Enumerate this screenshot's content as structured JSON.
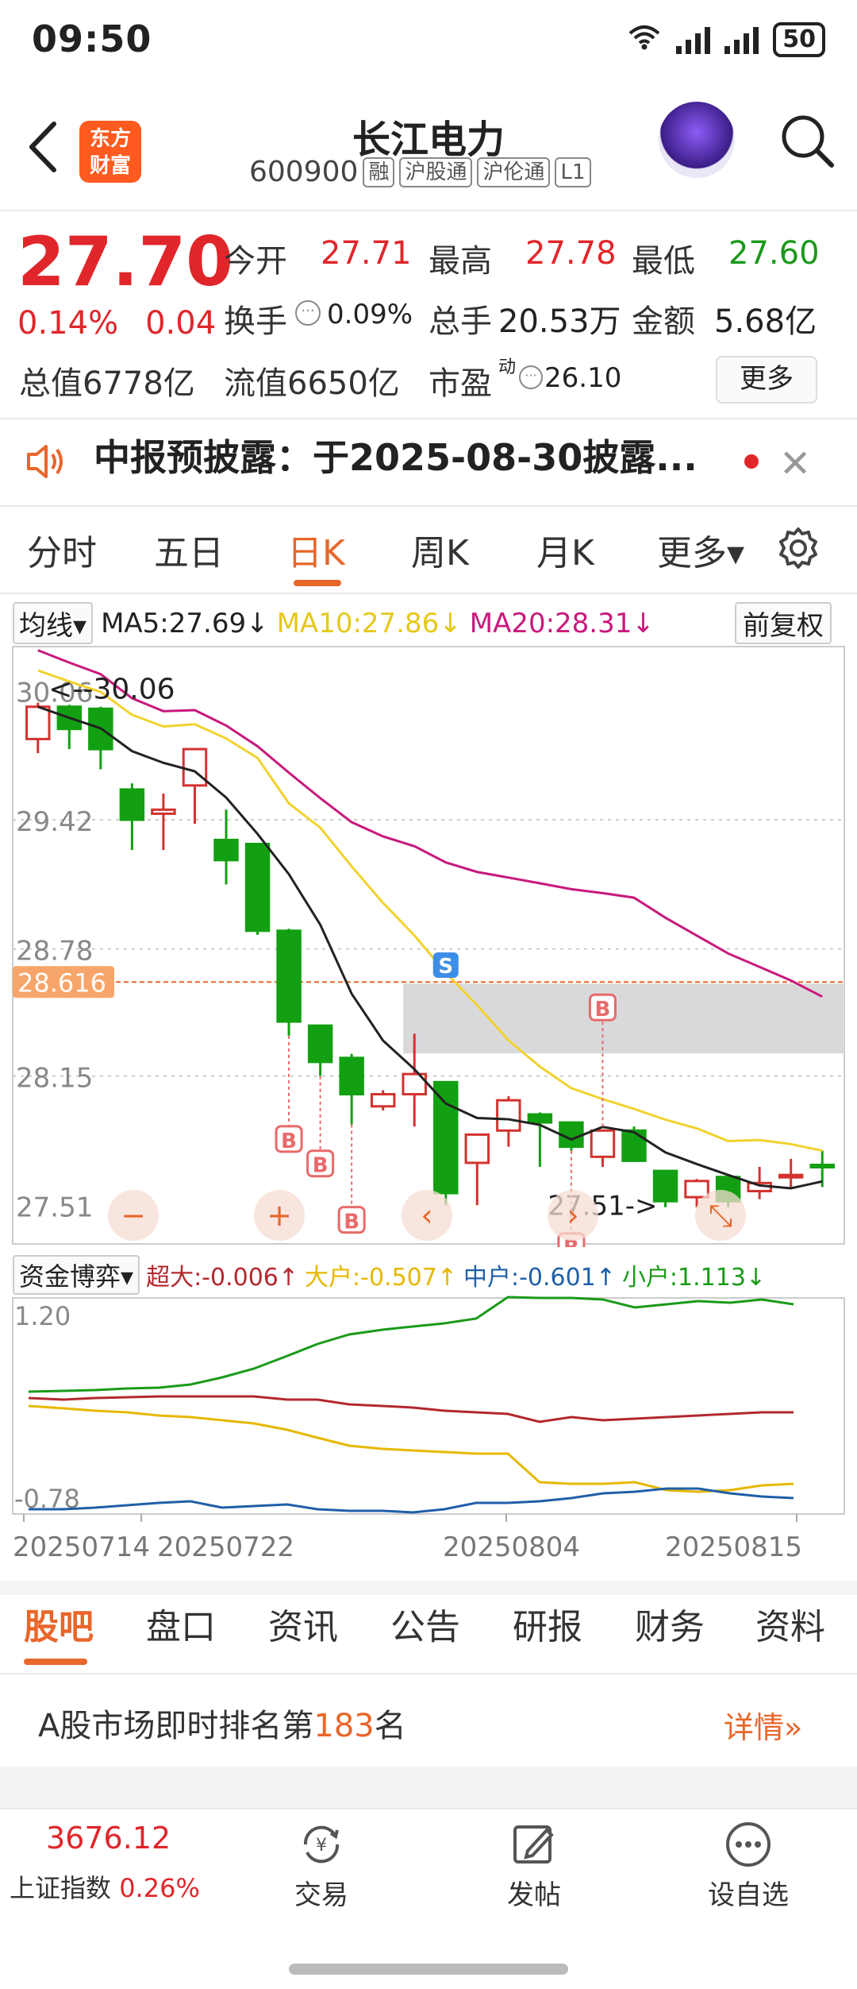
{
  "status": {
    "time": "09:50",
    "signal": "6G",
    "battery": "50"
  },
  "header": {
    "logo_line1": "东方",
    "logo_line2": "财富",
    "title": "长江电力",
    "code": "600900",
    "tags": [
      "融",
      "沪股通",
      "沪伦通",
      "L1"
    ]
  },
  "quote": {
    "price": "27.70",
    "pct": "0.14%",
    "chg": "0.04",
    "open_label": "今开",
    "open": "27.71",
    "high_label": "最高",
    "high": "27.78",
    "low_label": "最低",
    "low": "27.60",
    "turnover_label": "换手",
    "turnover": "0.09%",
    "volume_label": "总手",
    "volume": "20.53万",
    "amount_label": "金额",
    "amount": "5.68亿",
    "mktcap": "总值6778亿",
    "float": "流值6650亿",
    "pe_label": "市盈",
    "pe_sup": "动",
    "pe": "26.10",
    "more": "更多"
  },
  "notice": {
    "text": "中报预披露：于2025-08-30披露..."
  },
  "tabs": [
    "分时",
    "五日",
    "日K",
    "周K",
    "月K",
    "更多▾"
  ],
  "ma": {
    "selector": "均线▾",
    "ma5": "MA5:27.69↓",
    "ma10": "MA10:27.86↓",
    "ma20": "MA20:28.31↓",
    "adjust": "前复权",
    "colors": {
      "ma5": "#222222",
      "ma10": "#f2d22e",
      "ma20": "#c8197d"
    }
  },
  "kline": {
    "y_labels": [
      "30.06",
      "29.42",
      "28.78",
      "28.15",
      "27.51"
    ],
    "max_note": "<--30.06",
    "min_note": "27.51->",
    "price_line": "28.616",
    "buy_marker": "B",
    "sell_marker": "S"
  },
  "flow": {
    "selector": "资金博弈▾",
    "super": "超大:-0.006↑",
    "large": "大户:-0.507↑",
    "medium": "中户:-0.601↑",
    "small": "小户:1.113↓",
    "y_top": "1.20",
    "y_bottom": "-0.78",
    "colors": {
      "super": "#b3282e",
      "large": "#e6b800",
      "medium": "#1f5fa8",
      "small": "#1a9a1a"
    }
  },
  "dates": [
    "20250714",
    "20250722",
    "20250804",
    "20250815"
  ],
  "subtabs": [
    "股吧",
    "盘口",
    "资讯",
    "公告",
    "研报",
    "财务",
    "资料"
  ],
  "rank": {
    "prefix": "A股市场即时排名第",
    "num": "183",
    "suffix": "名",
    "detail": "详情»"
  },
  "bottom": {
    "index_value": "3676.12",
    "index_name": "上证指数",
    "index_pct": "0.26%",
    "items": [
      "交易",
      "发帖",
      "设自选"
    ]
  },
  "chart_data": {
    "type": "candlestick",
    "x": [
      "2025-07-14",
      "2025-07-15",
      "2025-07-16",
      "2025-07-17",
      "2025-07-18",
      "2025-07-21",
      "2025-07-22",
      "2025-07-23",
      "2025-07-24",
      "2025-07-25",
      "2025-07-28",
      "2025-07-29",
      "2025-07-30",
      "2025-07-31",
      "2025-08-01",
      "2025-08-04",
      "2025-08-05",
      "2025-08-06",
      "2025-08-07",
      "2025-08-08",
      "2025-08-11",
      "2025-08-12",
      "2025-08-13",
      "2025-08-14",
      "2025-08-15",
      "2025-08-18"
    ],
    "series": [
      {
        "name": "K",
        "ohlc": [
          [
            29.82,
            30.0,
            29.75,
            29.98
          ],
          [
            29.98,
            29.99,
            29.77,
            29.87
          ],
          [
            29.97,
            29.98,
            29.67,
            29.77
          ],
          [
            29.57,
            29.6,
            29.27,
            29.42
          ],
          [
            29.45,
            29.55,
            29.27,
            29.47
          ],
          [
            29.59,
            29.74,
            29.4,
            29.77
          ],
          [
            29.32,
            29.47,
            29.1,
            29.22
          ],
          [
            29.3,
            29.3,
            28.85,
            28.87
          ],
          [
            28.87,
            28.88,
            28.35,
            28.42
          ],
          [
            28.4,
            28.4,
            28.15,
            28.22
          ],
          [
            28.24,
            28.26,
            27.91,
            28.06
          ],
          [
            28.0,
            28.08,
            27.98,
            28.06
          ],
          [
            28.06,
            28.36,
            27.9,
            28.16
          ],
          [
            28.12,
            28.12,
            27.51,
            27.57
          ],
          [
            27.72,
            27.85,
            27.51,
            27.86
          ],
          [
            27.88,
            28.05,
            27.8,
            28.03
          ],
          [
            27.96,
            27.97,
            27.7,
            27.92
          ],
          [
            27.92,
            27.92,
            27.78,
            27.8
          ],
          [
            27.75,
            27.88,
            27.7,
            27.88
          ],
          [
            27.88,
            27.9,
            27.73,
            27.73
          ],
          [
            27.68,
            27.68,
            27.5,
            27.53
          ],
          [
            27.55,
            27.64,
            27.5,
            27.63
          ],
          [
            27.65,
            27.65,
            27.5,
            27.53
          ],
          [
            27.58,
            27.7,
            27.54,
            27.62
          ],
          [
            27.66,
            27.74,
            27.6,
            27.66
          ],
          [
            27.71,
            27.78,
            27.6,
            27.7
          ]
        ]
      }
    ]
  }
}
